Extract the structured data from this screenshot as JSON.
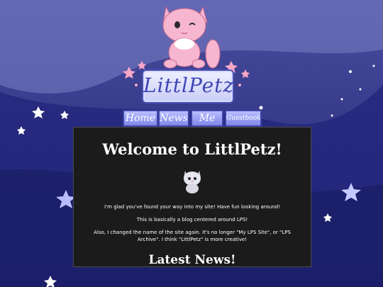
{
  "site": {
    "logo_text": "LittlPetz"
  },
  "nav": {
    "items": [
      {
        "label": "Home"
      },
      {
        "label": "News"
      },
      {
        "label": "Me"
      },
      {
        "label": "Guestbook"
      }
    ]
  },
  "content": {
    "title": "Welcome to LittlPetz!",
    "p1": "I'm glad you've found your way into my site! Have fun looking around!",
    "p2": "This is basically a blog centered around LPS!",
    "p3": "Also, I changed the name of the site again. It's no longer \"My LPS Site\", or \"LPS Archive\". I think \"LittlPetz\" is more creative!",
    "news_heading": "Latest News!"
  },
  "colors": {
    "background": "#2a2c86",
    "panel": "#1b1b1b",
    "accent": "#3f45b4",
    "mascot": "#f6b6cf"
  }
}
